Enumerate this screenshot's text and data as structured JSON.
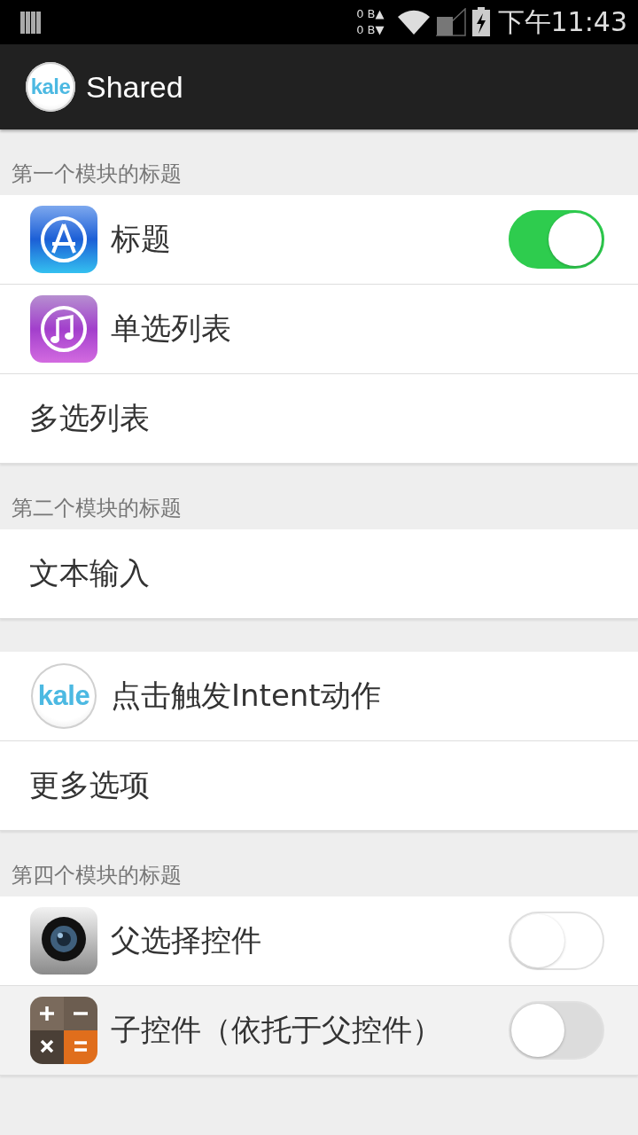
{
  "status_bar": {
    "upload": "0 B▲",
    "download": "0 B▼",
    "time": "下午11:43"
  },
  "app_bar": {
    "logo_text": "kale",
    "title": "Shared"
  },
  "sections": [
    {
      "header": "第一个模块的标题",
      "rows": [
        {
          "kind": "appstore",
          "label": "标题",
          "toggle": {
            "on": true,
            "disabled": false
          }
        },
        {
          "kind": "music",
          "label": "单选列表"
        },
        {
          "label": "多选列表"
        }
      ]
    },
    {
      "header": "第二个模块的标题",
      "rows": [
        {
          "label": "文本输入"
        }
      ]
    },
    {
      "rows": [
        {
          "kind": "logo",
          "logo_text": "kale",
          "label": "点击触发Intent动作"
        },
        {
          "label": "更多选项"
        }
      ]
    },
    {
      "header": "第四个模块的标题",
      "rows": [
        {
          "kind": "camera",
          "label": "父选择控件",
          "toggle": {
            "on": false,
            "disabled": false
          }
        },
        {
          "kind": "calculator",
          "label": "子控件（依托于父控件）",
          "toggle": {
            "on": false,
            "disabled": true
          }
        }
      ]
    }
  ]
}
